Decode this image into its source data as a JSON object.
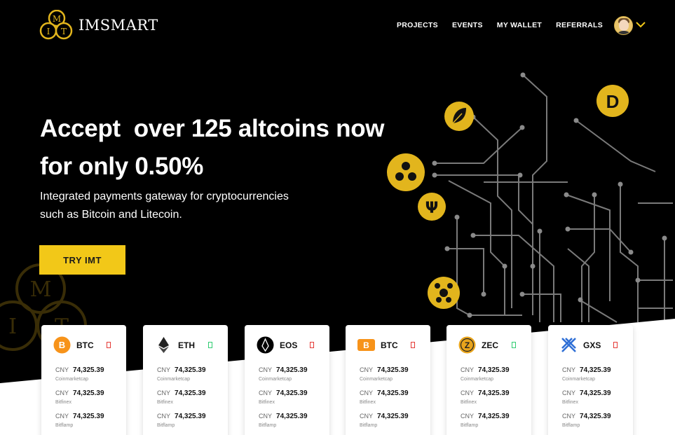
{
  "brand": {
    "name": "IMSMART",
    "accent": "#f2c818"
  },
  "nav": {
    "items": [
      "PROJECTS",
      "EVENTS",
      "MY WALLET",
      "REFERRALS"
    ]
  },
  "user": {
    "avatar": "avatar",
    "menu_icon": "chevron-down-icon"
  },
  "hero": {
    "title_line1": "Accept  over 125 altcoins now",
    "title_line2": "for only 0.50%",
    "subtitle_line1": "Integrated payments gateway for cryptocurrencies",
    "subtitle_line2": "such as Bitcoin and Litecoin.",
    "cta": "TRY IMT"
  },
  "cards": [
    {
      "symbol": "BTC",
      "icon": "bitcoin-icon",
      "trend": "down",
      "rows": [
        {
          "cur": "CNY",
          "val": "74,325.39",
          "src": "Coinmarketcap"
        },
        {
          "cur": "CNY",
          "val": "74,325.39",
          "src": "Bitfinex"
        },
        {
          "cur": "CNY",
          "val": "74,325.39",
          "src": "Bitflamp"
        }
      ]
    },
    {
      "symbol": "ETH",
      "icon": "ethereum-icon",
      "trend": "up",
      "rows": [
        {
          "cur": "CNY",
          "val": "74,325.39",
          "src": "Coinmarketcap"
        },
        {
          "cur": "CNY",
          "val": "74,325.39",
          "src": "Bitfinex"
        },
        {
          "cur": "CNY",
          "val": "74,325.39",
          "src": "Bitflamp"
        }
      ]
    },
    {
      "symbol": "EOS",
      "icon": "eos-icon",
      "trend": "down",
      "rows": [
        {
          "cur": "CNY",
          "val": "74,325.39",
          "src": "Coinmarketcap"
        },
        {
          "cur": "CNY",
          "val": "74,325.39",
          "src": "Bitfinex"
        },
        {
          "cur": "CNY",
          "val": "74,325.39",
          "src": "Bitflamp"
        }
      ]
    },
    {
      "symbol": "BTC",
      "icon": "bitcoin-cash-icon",
      "trend": "down",
      "rows": [
        {
          "cur": "CNY",
          "val": "74,325.39",
          "src": "Coinmarketcap"
        },
        {
          "cur": "CNY",
          "val": "74,325.39",
          "src": "Bitfinex"
        },
        {
          "cur": "CNY",
          "val": "74,325.39",
          "src": "Bitflamp"
        }
      ]
    },
    {
      "symbol": "ZEC",
      "icon": "zcash-icon",
      "trend": "up",
      "rows": [
        {
          "cur": "CNY",
          "val": "74,325.39",
          "src": "Coinmarketcap"
        },
        {
          "cur": "CNY",
          "val": "74,325.39",
          "src": "Bitfinex"
        },
        {
          "cur": "CNY",
          "val": "74,325.39",
          "src": "Bitflamp"
        }
      ]
    },
    {
      "symbol": "GXS",
      "icon": "gxshares-icon",
      "trend": "down",
      "rows": [
        {
          "cur": "CNY",
          "val": "74,325.39",
          "src": "Coinmarketcap"
        },
        {
          "cur": "CNY",
          "val": "74,325.39",
          "src": "Bitfinex"
        },
        {
          "cur": "CNY",
          "val": "74,325.39",
          "src": "Bitflamp"
        }
      ]
    }
  ],
  "decor": {
    "coin_icons": [
      "leaf-coin-icon",
      "dogecoin-icon",
      "ripple-icon",
      "psi-coin-icon",
      "network-coin-icon"
    ],
    "circuit_color": "#7a7a7a",
    "trend_colors": {
      "up": "#2ecc71",
      "down": "#e53935"
    }
  }
}
